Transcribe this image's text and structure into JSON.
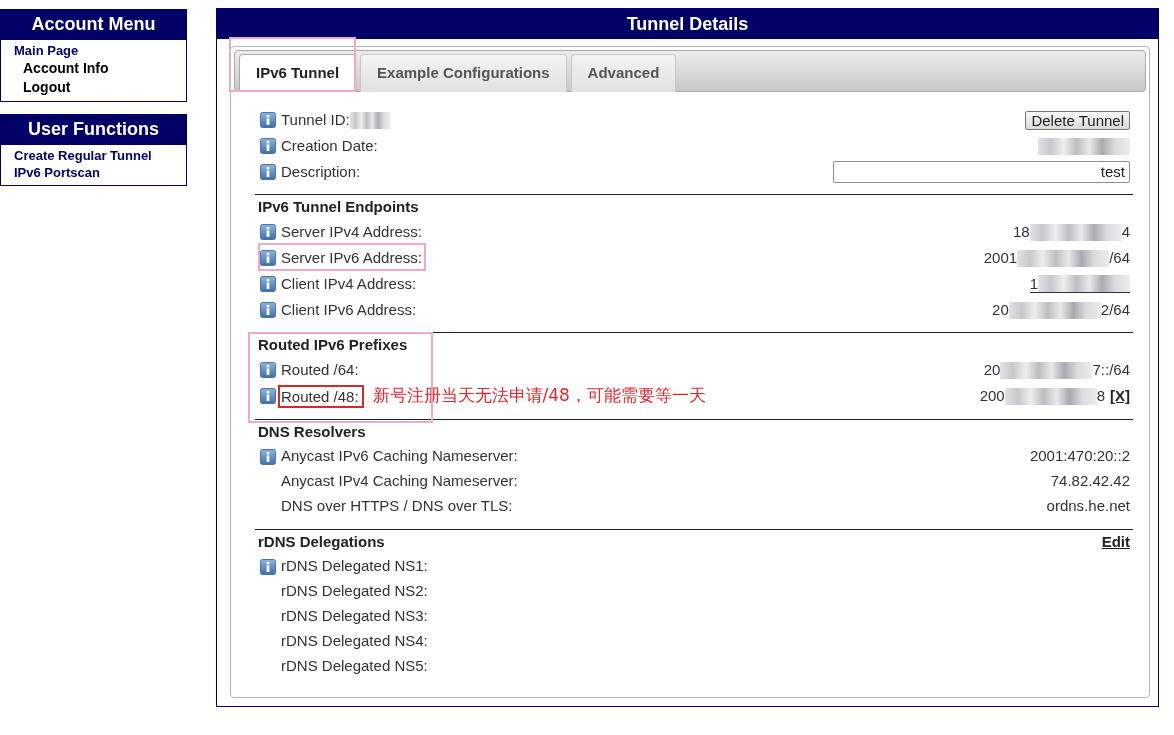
{
  "sidebar": [
    {
      "title": "Account Menu",
      "items": [
        {
          "label": "Main Page",
          "children": [
            {
              "label": "Account Info"
            },
            {
              "label": "Logout"
            }
          ]
        }
      ]
    },
    {
      "title": "User Functions",
      "items": [
        {
          "label": "Create Regular Tunnel"
        },
        {
          "label": "IPv6 Portscan"
        }
      ]
    }
  ],
  "panel": {
    "title": "Tunnel Details",
    "tabs": [
      {
        "label": "IPv6 Tunnel",
        "selected": true,
        "highlighted": true
      },
      {
        "label": "Example Configurations",
        "selected": false,
        "highlighted": false
      },
      {
        "label": "Advanced",
        "selected": false,
        "highlighted": false
      }
    ],
    "sections": [
      {
        "highlighted": false,
        "rows": [
          {
            "label": "Tunnel ID:",
            "info": true,
            "highlighted": false,
            "label_value": {
              "kind": "redacted"
            },
            "value": {
              "kind": "button",
              "text": "Delete Tunnel"
            }
          },
          {
            "label": "Creation Date:",
            "info": true,
            "highlighted": false,
            "value": {
              "kind": "redacted",
              "link": false
            }
          },
          {
            "label": "Description:",
            "info": true,
            "highlighted": false,
            "value": {
              "kind": "input",
              "text": "test"
            }
          }
        ]
      },
      {
        "heading": "IPv6 Tunnel Endpoints",
        "highlighted": false,
        "rows": [
          {
            "label": "Server IPv4 Address:",
            "info": true,
            "highlighted": false,
            "value": {
              "kind": "redacted",
              "link": false,
              "prefix": "18",
              "suffix": "4"
            }
          },
          {
            "label": "Server IPv6 Address:",
            "info": true,
            "highlighted": true,
            "value": {
              "kind": "redacted",
              "link": false,
              "prefix": "2001",
              "suffix": "/64"
            }
          },
          {
            "label": "Client IPv4 Address:",
            "info": true,
            "highlighted": false,
            "value": {
              "kind": "redacted",
              "link": true,
              "prefix": "1"
            }
          },
          {
            "label": "Client IPv6 Address:",
            "info": true,
            "highlighted": false,
            "value": {
              "kind": "redacted",
              "link": false,
              "prefix": "20",
              "suffix": "2/64"
            }
          }
        ]
      },
      {
        "heading": "Routed IPv6 Prefixes",
        "highlighted": true,
        "rows": [
          {
            "label": "Routed /64:",
            "info": true,
            "highlighted": false,
            "value": {
              "kind": "redacted",
              "link": false,
              "prefix": "20",
              "suffix": "7::/64"
            }
          },
          {
            "label": "Routed /48:",
            "info": true,
            "highlighted": false,
            "annotation": {
              "text": "新号注册当天无法申请/48，可能需要等一天",
              "boxed": true
            },
            "value": {
              "kind": "redacted",
              "link": false,
              "prefix": "200",
              "suffix": "8",
              "action": "[X]"
            }
          }
        ]
      },
      {
        "heading": "DNS Resolvers",
        "highlighted": false,
        "rows": [
          {
            "label": "Anycast IPv6 Caching Nameserver:",
            "info": true,
            "highlighted": false,
            "value": {
              "kind": "text",
              "text": "2001:470:20::2"
            }
          },
          {
            "label": "Anycast IPv4 Caching Nameserver:",
            "info": false,
            "highlighted": false,
            "value": {
              "kind": "text",
              "text": "74.82.42.42"
            }
          },
          {
            "label": "DNS over HTTPS / DNS over TLS:",
            "info": false,
            "highlighted": false,
            "value": {
              "kind": "text",
              "text": "ordns.he.net"
            }
          }
        ]
      },
      {
        "heading": "rDNS Delegations",
        "action": "Edit",
        "highlighted": false,
        "rows": [
          {
            "label": "rDNS Delegated NS1:",
            "info": true,
            "highlighted": false
          },
          {
            "label": "rDNS Delegated NS2:",
            "info": false,
            "highlighted": false
          },
          {
            "label": "rDNS Delegated NS3:",
            "info": false,
            "highlighted": false
          },
          {
            "label": "rDNS Delegated NS4:",
            "info": false,
            "highlighted": false
          },
          {
            "label": "rDNS Delegated NS5:",
            "info": false,
            "highlighted": false
          }
        ]
      }
    ]
  }
}
